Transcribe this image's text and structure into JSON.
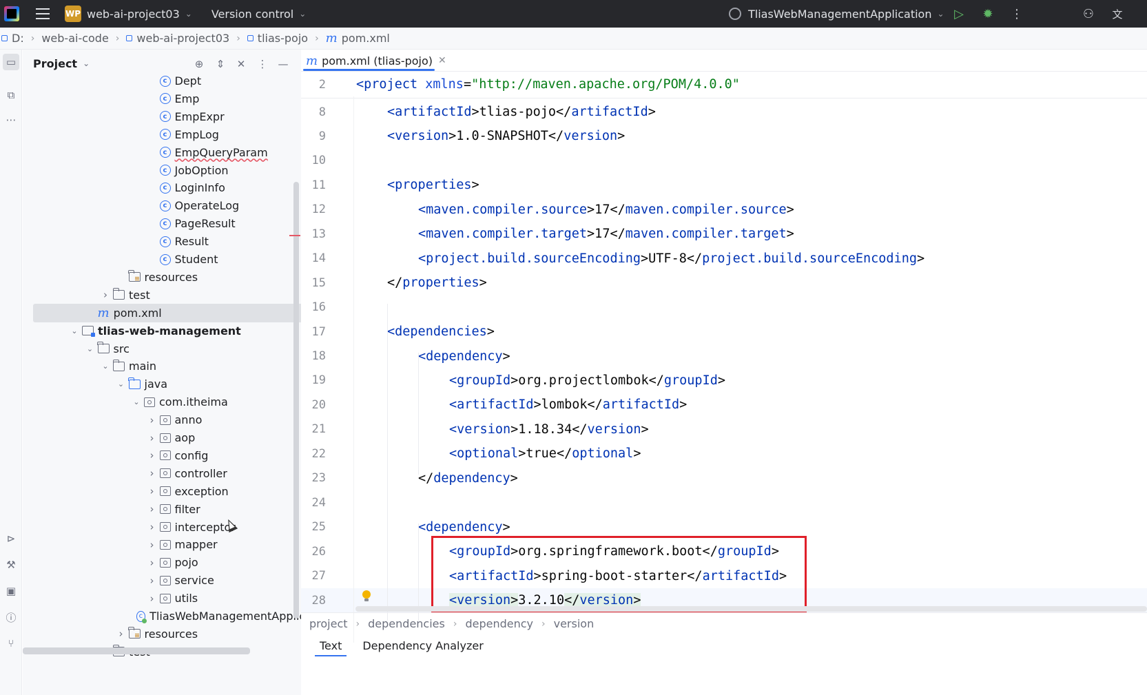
{
  "titlebar": {
    "project_badge": "WP",
    "project_name": "web-ai-project03",
    "vcs": "Version control",
    "run_config": "TliasWebManagementApplication"
  },
  "breadcrumb": [
    "D:",
    "web-ai-code",
    "web-ai-project03",
    "tlias-pojo",
    "pom.xml"
  ],
  "project_panel": {
    "title": "Project",
    "tree": [
      {
        "label": "Dept",
        "kind": "class",
        "indent": 3
      },
      {
        "label": "Emp",
        "kind": "class",
        "indent": 3
      },
      {
        "label": "EmpExpr",
        "kind": "class",
        "indent": 3
      },
      {
        "label": "EmpLog",
        "kind": "class",
        "indent": 3
      },
      {
        "label": "EmpQueryParam",
        "kind": "class",
        "indent": 3,
        "error": true
      },
      {
        "label": "JobOption",
        "kind": "class",
        "indent": 3
      },
      {
        "label": "LoginInfo",
        "kind": "class",
        "indent": 3
      },
      {
        "label": "OperateLog",
        "kind": "class",
        "indent": 3
      },
      {
        "label": "PageResult",
        "kind": "class",
        "indent": 3
      },
      {
        "label": "Result",
        "kind": "class",
        "indent": 3
      },
      {
        "label": "Student",
        "kind": "class",
        "indent": 3
      },
      {
        "label": "resources",
        "kind": "res-folder",
        "indent": 1
      },
      {
        "label": "test",
        "kind": "folder",
        "indent": 0,
        "arrow": "right"
      },
      {
        "label": "pom.xml",
        "kind": "maven",
        "indent": -1,
        "selected": true
      },
      {
        "label": "tlias-web-management",
        "kind": "module",
        "indent": -2,
        "arrow": "down",
        "bold": true
      },
      {
        "label": "src",
        "kind": "folder",
        "indent": -1,
        "arrow": "down"
      },
      {
        "label": "main",
        "kind": "folder",
        "indent": 0,
        "arrow": "down"
      },
      {
        "label": "java",
        "kind": "src-folder",
        "indent": 1,
        "arrow": "down"
      },
      {
        "label": "com.itheima",
        "kind": "package",
        "indent": 2,
        "arrow": "down"
      },
      {
        "label": "anno",
        "kind": "package",
        "indent": 3,
        "arrow": "right"
      },
      {
        "label": "aop",
        "kind": "package",
        "indent": 3,
        "arrow": "right"
      },
      {
        "label": "config",
        "kind": "package",
        "indent": 3,
        "arrow": "right"
      },
      {
        "label": "controller",
        "kind": "package",
        "indent": 3,
        "arrow": "right"
      },
      {
        "label": "exception",
        "kind": "package",
        "indent": 3,
        "arrow": "right"
      },
      {
        "label": "filter",
        "kind": "package",
        "indent": 3,
        "arrow": "right"
      },
      {
        "label": "interceptor",
        "kind": "package",
        "indent": 3,
        "arrow": "right"
      },
      {
        "label": "mapper",
        "kind": "package",
        "indent": 3,
        "arrow": "right"
      },
      {
        "label": "pojo",
        "kind": "package",
        "indent": 3,
        "arrow": "right"
      },
      {
        "label": "service",
        "kind": "package",
        "indent": 3,
        "arrow": "right"
      },
      {
        "label": "utils",
        "kind": "package",
        "indent": 3,
        "arrow": "right"
      },
      {
        "label": "TliasWebManagementApplica",
        "kind": "app",
        "indent": 3
      },
      {
        "label": "resources",
        "kind": "res-folder",
        "indent": 1,
        "arrow": "right"
      },
      {
        "label": "test",
        "kind": "folder",
        "indent": 0,
        "arrow": "right"
      }
    ]
  },
  "editor": {
    "tab_label": "pom.xml (tlias-pojo)",
    "sticky": {
      "num": "2",
      "indent": 0,
      "tokens": [
        [
          "t",
          "<project "
        ],
        [
          "a",
          "xmlns"
        ],
        [
          "p",
          "="
        ],
        [
          "s",
          "\"http://maven.apache.org/POM/4.0.0\""
        ]
      ]
    },
    "lines": [
      {
        "num": "8",
        "indent": 1,
        "tokens": [
          [
            "t",
            "<artifactId"
          ],
          [
            "p",
            ">tlias-pojo</"
          ],
          [
            "t",
            "artifactId"
          ],
          [
            "p",
            ">"
          ]
        ]
      },
      {
        "num": "9",
        "indent": 1,
        "tokens": [
          [
            "t",
            "<version"
          ],
          [
            "p",
            ">1.0-SNAPSHOT</"
          ],
          [
            "t",
            "version"
          ],
          [
            "p",
            ">"
          ]
        ]
      },
      {
        "num": "10",
        "indent": 0,
        "tokens": []
      },
      {
        "num": "11",
        "indent": 1,
        "tokens": [
          [
            "t",
            "<properties"
          ],
          [
            "p",
            ">"
          ]
        ]
      },
      {
        "num": "12",
        "indent": 2,
        "tokens": [
          [
            "t",
            "<maven.compiler.source"
          ],
          [
            "p",
            ">17</"
          ],
          [
            "t",
            "maven.compiler.source"
          ],
          [
            "p",
            ">"
          ]
        ]
      },
      {
        "num": "13",
        "indent": 2,
        "tokens": [
          [
            "t",
            "<maven.compiler.target"
          ],
          [
            "p",
            ">17</"
          ],
          [
            "t",
            "maven.compiler.target"
          ],
          [
            "p",
            ">"
          ]
        ]
      },
      {
        "num": "14",
        "indent": 2,
        "tokens": [
          [
            "t",
            "<project.build.sourceEncoding"
          ],
          [
            "p",
            ">UTF-8</"
          ],
          [
            "t",
            "project.build.sourceEncoding"
          ],
          [
            "p",
            ">"
          ]
        ]
      },
      {
        "num": "15",
        "indent": 1,
        "tokens": [
          [
            "p",
            "</"
          ],
          [
            "t",
            "properties"
          ],
          [
            "p",
            ">"
          ]
        ]
      },
      {
        "num": "16",
        "indent": 0,
        "tokens": []
      },
      {
        "num": "17",
        "indent": 1,
        "tokens": [
          [
            "t",
            "<dependencies"
          ],
          [
            "p",
            ">"
          ]
        ]
      },
      {
        "num": "18",
        "indent": 2,
        "tokens": [
          [
            "t",
            "<dependency"
          ],
          [
            "p",
            ">"
          ]
        ]
      },
      {
        "num": "19",
        "indent": 3,
        "tokens": [
          [
            "t",
            "<groupId"
          ],
          [
            "p",
            ">org.projectlombok</"
          ],
          [
            "t",
            "groupId"
          ],
          [
            "p",
            ">"
          ]
        ]
      },
      {
        "num": "20",
        "indent": 3,
        "tokens": [
          [
            "t",
            "<artifactId"
          ],
          [
            "p",
            ">lombok</"
          ],
          [
            "t",
            "artifactId"
          ],
          [
            "p",
            ">"
          ]
        ]
      },
      {
        "num": "21",
        "indent": 3,
        "tokens": [
          [
            "t",
            "<version"
          ],
          [
            "p",
            ">1.18.34</"
          ],
          [
            "t",
            "version"
          ],
          [
            "p",
            ">"
          ]
        ]
      },
      {
        "num": "22",
        "indent": 3,
        "tokens": [
          [
            "t",
            "<optional"
          ],
          [
            "p",
            ">true</"
          ],
          [
            "t",
            "optional"
          ],
          [
            "p",
            ">"
          ]
        ]
      },
      {
        "num": "23",
        "indent": 2,
        "tokens": [
          [
            "p",
            "</"
          ],
          [
            "t",
            "dependency"
          ],
          [
            "p",
            ">"
          ]
        ]
      },
      {
        "num": "24",
        "indent": 0,
        "tokens": []
      },
      {
        "num": "25",
        "indent": 2,
        "tokens": [
          [
            "t",
            "<dependency"
          ],
          [
            "p",
            ">"
          ]
        ]
      },
      {
        "num": "26",
        "indent": 3,
        "tokens": [
          [
            "t",
            "<groupId"
          ],
          [
            "p",
            ">org.springframework.boot</"
          ],
          [
            "t",
            "groupId"
          ],
          [
            "p",
            ">"
          ]
        ]
      },
      {
        "num": "27",
        "indent": 3,
        "tokens": [
          [
            "t",
            "<artifactId"
          ],
          [
            "p",
            ">spring-boot-starter</"
          ],
          [
            "t",
            "artifactId"
          ],
          [
            "p",
            ">"
          ]
        ]
      },
      {
        "num": "28",
        "indent": 3,
        "caret": true,
        "tokens": [
          [
            "th",
            "<version"
          ],
          [
            "ph",
            ">"
          ],
          [
            "p",
            "3.2.10"
          ],
          [
            "ph",
            "</"
          ],
          [
            "th",
            "version"
          ],
          [
            "ph",
            ">"
          ]
        ]
      }
    ],
    "breadcrumb": [
      "project",
      "dependencies",
      "dependency",
      "version"
    ]
  },
  "bottom_tabs": [
    "Text",
    "Dependency Analyzer"
  ],
  "colors": {
    "tag": "#0033b3",
    "string": "#067d17",
    "accent": "#3574f0",
    "highlight_box": "#e0202a"
  }
}
